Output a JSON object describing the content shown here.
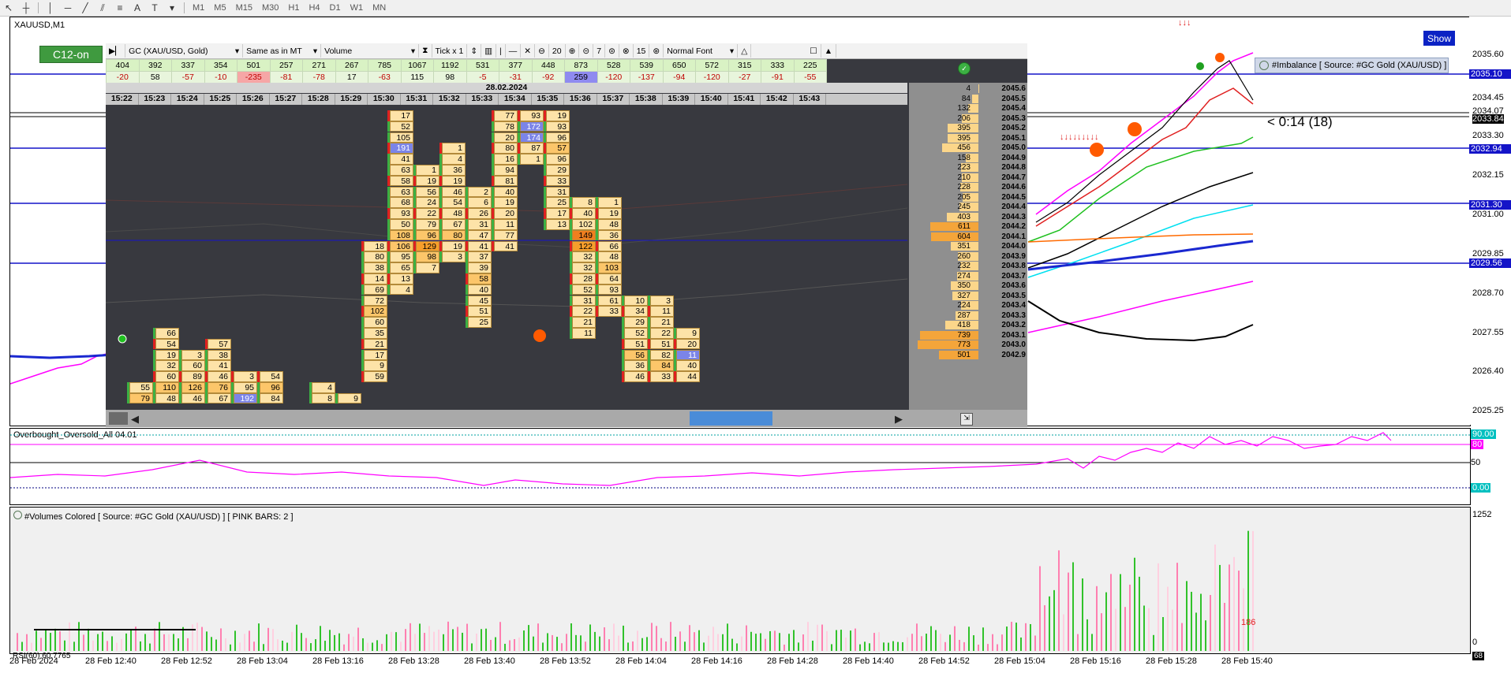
{
  "toolbar": {
    "timeframes": [
      "M1",
      "M5",
      "M15",
      "M30",
      "H1",
      "H4",
      "D1",
      "W1",
      "MN"
    ]
  },
  "chart": {
    "symbol": "XAUUSD,M1",
    "c12_label": "C12-on",
    "show_label": "Show",
    "timer": "< 0:14 (18)",
    "imbalance_label": "#Imbalance [ Source: #GC Gold (XAU/USD) ]",
    "price_labels": [
      "2035.60",
      "2034.45",
      "2034.07",
      "2033.84",
      "2033.30",
      "2032.15",
      "2031.00",
      "2029.85",
      "2028.70",
      "2027.55",
      "2026.40",
      "2025.25"
    ],
    "level_boxes": [
      {
        "value": "2035.10",
        "color": "#1414c8"
      },
      {
        "value": "2032.94",
        "color": "#1414c8"
      },
      {
        "value": "2031.30",
        "color": "#1414c8"
      },
      {
        "value": "2029.56",
        "color": "#1414c8"
      }
    ]
  },
  "footprint": {
    "symbol_select": "GC (XAU/USD, Gold)",
    "mode_select": "Same as in MT",
    "volume_select": "Volume",
    "tick_label": "Tick x 1",
    "zoom_value": "20",
    "step_value": "7",
    "ladder_value": "15",
    "font_select": "Normal Font",
    "date": "28.02.2024",
    "totals": [
      "404",
      "392",
      "337",
      "354",
      "501",
      "257",
      "271",
      "267",
      "785",
      "1067",
      "1192",
      "531",
      "377",
      "448",
      "873",
      "528",
      "539",
      "650",
      "572",
      "315",
      "333",
      "225"
    ],
    "deltas": [
      "-20",
      "58",
      "-57",
      "-10",
      "-235",
      "-81",
      "-78",
      "17",
      "-63",
      "115",
      "98",
      "-5",
      "-31",
      "-92",
      "259",
      "-120",
      "-137",
      "-94",
      "-120",
      "-27",
      "-91",
      "-55"
    ],
    "times": [
      "15:22",
      "15:23",
      "15:24",
      "15:25",
      "15:26",
      "15:27",
      "15:28",
      "15:29",
      "15:30",
      "15:31",
      "15:32",
      "15:33",
      "15:34",
      "15:35",
      "15:36",
      "15:37",
      "15:38",
      "15:39",
      "15:40",
      "15:41",
      "15:42",
      "15:43"
    ],
    "profile": [
      {
        "v": "4",
        "p": "2045.6"
      },
      {
        "v": "84",
        "p": "2045.5"
      },
      {
        "v": "132",
        "p": "2045.4"
      },
      {
        "v": "206",
        "p": "2045.3"
      },
      {
        "v": "395",
        "p": "2045.2"
      },
      {
        "v": "395",
        "p": "2045.1"
      },
      {
        "v": "456",
        "p": "2045.0"
      },
      {
        "v": "158",
        "p": "2044.9"
      },
      {
        "v": "223",
        "p": "2044.8"
      },
      {
        "v": "210",
        "p": "2044.7"
      },
      {
        "v": "228",
        "p": "2044.6"
      },
      {
        "v": "205",
        "p": "2044.5"
      },
      {
        "v": "245",
        "p": "2044.4"
      },
      {
        "v": "403",
        "p": "2044.3"
      },
      {
        "v": "611",
        "p": "2044.2"
      },
      {
        "v": "604",
        "p": "2044.1"
      },
      {
        "v": "351",
        "p": "2044.0"
      },
      {
        "v": "260",
        "p": "2043.9"
      },
      {
        "v": "232",
        "p": "2043.8"
      },
      {
        "v": "274",
        "p": "2043.7"
      },
      {
        "v": "350",
        "p": "2043.6"
      },
      {
        "v": "327",
        "p": "2043.5"
      },
      {
        "v": "224",
        "p": "2043.4"
      },
      {
        "v": "287",
        "p": "2043.3"
      },
      {
        "v": "418",
        "p": "2043.2"
      },
      {
        "v": "739",
        "p": "2043.1"
      },
      {
        "v": "773",
        "p": "2043.0"
      },
      {
        "v": "501",
        "p": "2042.9"
      }
    ],
    "cells": [
      {
        "c": 1,
        "r": 20,
        "v": "66",
        "t": "lo"
      },
      {
        "c": 1,
        "r": 21,
        "v": "54",
        "t": "lo"
      },
      {
        "c": 1,
        "r": 22,
        "v": "19",
        "t": "lo"
      },
      {
        "c": 1,
        "r": 23,
        "v": "32",
        "t": "lo"
      },
      {
        "c": 1,
        "r": 24,
        "v": "60",
        "t": "lo"
      },
      {
        "c": 1,
        "r": 25,
        "v": "110",
        "t": "mid"
      },
      {
        "c": 1,
        "r": 26,
        "v": "48",
        "t": "lo"
      },
      {
        "c": 0,
        "r": 25,
        "v": "55",
        "t": "lo"
      },
      {
        "c": 0,
        "r": 26,
        "v": "79",
        "t": "mid"
      },
      {
        "c": 2,
        "r": 22,
        "v": "3",
        "t": "lo"
      },
      {
        "c": 2,
        "r": 23,
        "v": "60",
        "t": "lo"
      },
      {
        "c": 2,
        "r": 24,
        "v": "89",
        "t": "lo"
      },
      {
        "c": 2,
        "r": 25,
        "v": "126",
        "t": "mid"
      },
      {
        "c": 2,
        "r": 26,
        "v": "46",
        "t": "lo"
      },
      {
        "c": 3,
        "r": 21,
        "v": "57",
        "t": "lo"
      },
      {
        "c": 3,
        "r": 22,
        "v": "38",
        "t": "lo"
      },
      {
        "c": 3,
        "r": 23,
        "v": "41",
        "t": "lo"
      },
      {
        "c": 3,
        "r": 24,
        "v": "46",
        "t": "lo"
      },
      {
        "c": 3,
        "r": 25,
        "v": "76",
        "t": "mid"
      },
      {
        "c": 3,
        "r": 26,
        "v": "67",
        "t": "lo"
      },
      {
        "c": 4,
        "r": 24,
        "v": "3",
        "t": "lo"
      },
      {
        "c": 4,
        "r": 25,
        "v": "95",
        "t": "lo"
      },
      {
        "c": 4,
        "r": 26,
        "v": "192",
        "t": "blue"
      },
      {
        "c": 5,
        "r": 24,
        "v": "54",
        "t": "lo"
      },
      {
        "c": 5,
        "r": 25,
        "v": "96",
        "t": "mid"
      },
      {
        "c": 5,
        "r": 26,
        "v": "84",
        "t": "lo"
      },
      {
        "c": 7,
        "r": 25,
        "v": "4",
        "t": "lo"
      },
      {
        "c": 7,
        "r": 26,
        "v": "8",
        "t": "lo"
      },
      {
        "c": 8,
        "r": 26,
        "v": "9",
        "t": "lo"
      },
      {
        "c": 9,
        "r": 12,
        "v": "18",
        "t": "lo"
      },
      {
        "c": 9,
        "r": 13,
        "v": "80",
        "t": "lo"
      },
      {
        "c": 9,
        "r": 14,
        "v": "38",
        "t": "lo"
      },
      {
        "c": 9,
        "r": 15,
        "v": "14",
        "t": "lo"
      },
      {
        "c": 9,
        "r": 16,
        "v": "69",
        "t": "lo"
      },
      {
        "c": 9,
        "r": 17,
        "v": "72",
        "t": "lo"
      },
      {
        "c": 9,
        "r": 18,
        "v": "102",
        "t": "mid"
      },
      {
        "c": 9,
        "r": 19,
        "v": "60",
        "t": "lo"
      },
      {
        "c": 9,
        "r": 20,
        "v": "35",
        "t": "lo"
      },
      {
        "c": 9,
        "r": 21,
        "v": "21",
        "t": "lo"
      },
      {
        "c": 9,
        "r": 22,
        "v": "17",
        "t": "lo"
      },
      {
        "c": 9,
        "r": 23,
        "v": "9",
        "t": "lo"
      },
      {
        "c": 9,
        "r": 24,
        "v": "59",
        "t": "lo"
      },
      {
        "c": 10,
        "r": 0,
        "v": "17",
        "t": "lo"
      },
      {
        "c": 10,
        "r": 1,
        "v": "52",
        "t": "lo"
      },
      {
        "c": 10,
        "r": 2,
        "v": "105",
        "t": "lo"
      },
      {
        "c": 10,
        "r": 3,
        "v": "191",
        "t": "blue"
      },
      {
        "c": 10,
        "r": 4,
        "v": "41",
        "t": "lo"
      },
      {
        "c": 10,
        "r": 5,
        "v": "63",
        "t": "lo"
      },
      {
        "c": 10,
        "r": 6,
        "v": "58",
        "t": "lo"
      },
      {
        "c": 10,
        "r": 7,
        "v": "63",
        "t": "lo"
      },
      {
        "c": 10,
        "r": 8,
        "v": "68",
        "t": "lo"
      },
      {
        "c": 10,
        "r": 9,
        "v": "93",
        "t": "lo"
      },
      {
        "c": 10,
        "r": 10,
        "v": "50",
        "t": "lo"
      },
      {
        "c": 10,
        "r": 11,
        "v": "108",
        "t": "mid"
      },
      {
        "c": 10,
        "r": 12,
        "v": "106",
        "t": "mid"
      },
      {
        "c": 10,
        "r": 13,
        "v": "95",
        "t": "lo"
      },
      {
        "c": 10,
        "r": 14,
        "v": "65",
        "t": "lo"
      },
      {
        "c": 10,
        "r": 15,
        "v": "13",
        "t": "lo"
      },
      {
        "c": 10,
        "r": 16,
        "v": "4",
        "t": "lo"
      },
      {
        "c": 11,
        "r": 5,
        "v": "1",
        "t": "lo"
      },
      {
        "c": 11,
        "r": 6,
        "v": "19",
        "t": "lo"
      },
      {
        "c": 11,
        "r": 7,
        "v": "56",
        "t": "lo"
      },
      {
        "c": 11,
        "r": 8,
        "v": "24",
        "t": "lo"
      },
      {
        "c": 11,
        "r": 9,
        "v": "22",
        "t": "lo"
      },
      {
        "c": 11,
        "r": 10,
        "v": "79",
        "t": "lo"
      },
      {
        "c": 11,
        "r": 11,
        "v": "96",
        "t": "mid"
      },
      {
        "c": 11,
        "r": 12,
        "v": "129",
        "t": "hi"
      },
      {
        "c": 11,
        "r": 13,
        "v": "98",
        "t": "mid"
      },
      {
        "c": 11,
        "r": 14,
        "v": "7",
        "t": "lo"
      },
      {
        "c": 12,
        "r": 3,
        "v": "1",
        "t": "lo"
      },
      {
        "c": 12,
        "r": 4,
        "v": "4",
        "t": "lo"
      },
      {
        "c": 12,
        "r": 5,
        "v": "36",
        "t": "lo"
      },
      {
        "c": 12,
        "r": 6,
        "v": "19",
        "t": "lo"
      },
      {
        "c": 12,
        "r": 7,
        "v": "46",
        "t": "lo"
      },
      {
        "c": 12,
        "r": 8,
        "v": "54",
        "t": "lo"
      },
      {
        "c": 12,
        "r": 9,
        "v": "48",
        "t": "lo"
      },
      {
        "c": 12,
        "r": 10,
        "v": "67",
        "t": "lo"
      },
      {
        "c": 12,
        "r": 11,
        "v": "80",
        "t": "mid"
      },
      {
        "c": 12,
        "r": 12,
        "v": "19",
        "t": "lo"
      },
      {
        "c": 12,
        "r": 13,
        "v": "3",
        "t": "lo"
      },
      {
        "c": 13,
        "r": 7,
        "v": "2",
        "t": "lo"
      },
      {
        "c": 13,
        "r": 8,
        "v": "6",
        "t": "lo"
      },
      {
        "c": 13,
        "r": 9,
        "v": "26",
        "t": "lo"
      },
      {
        "c": 13,
        "r": 10,
        "v": "31",
        "t": "lo"
      },
      {
        "c": 13,
        "r": 11,
        "v": "47",
        "t": "lo"
      },
      {
        "c": 13,
        "r": 12,
        "v": "41",
        "t": "lo"
      },
      {
        "c": 13,
        "r": 13,
        "v": "37",
        "t": "lo"
      },
      {
        "c": 13,
        "r": 14,
        "v": "39",
        "t": "lo"
      },
      {
        "c": 13,
        "r": 15,
        "v": "58",
        "t": "mid"
      },
      {
        "c": 13,
        "r": 16,
        "v": "40",
        "t": "lo"
      },
      {
        "c": 13,
        "r": 17,
        "v": "45",
        "t": "lo"
      },
      {
        "c": 13,
        "r": 18,
        "v": "51",
        "t": "lo"
      },
      {
        "c": 13,
        "r": 19,
        "v": "25",
        "t": "lo"
      },
      {
        "c": 14,
        "r": 0,
        "v": "77",
        "t": "lo"
      },
      {
        "c": 14,
        "r": 1,
        "v": "78",
        "t": "lo"
      },
      {
        "c": 14,
        "r": 2,
        "v": "20",
        "t": "lo"
      },
      {
        "c": 14,
        "r": 3,
        "v": "80",
        "t": "lo"
      },
      {
        "c": 14,
        "r": 4,
        "v": "16",
        "t": "lo"
      },
      {
        "c": 14,
        "r": 5,
        "v": "94",
        "t": "lo"
      },
      {
        "c": 14,
        "r": 6,
        "v": "81",
        "t": "lo"
      },
      {
        "c": 14,
        "r": 7,
        "v": "40",
        "t": "lo"
      },
      {
        "c": 14,
        "r": 8,
        "v": "19",
        "t": "lo"
      },
      {
        "c": 14,
        "r": 9,
        "v": "20",
        "t": "lo"
      },
      {
        "c": 14,
        "r": 10,
        "v": "11",
        "t": "lo"
      },
      {
        "c": 14,
        "r": 11,
        "v": "77",
        "t": "lo"
      },
      {
        "c": 14,
        "r": 12,
        "v": "41",
        "t": "lo"
      },
      {
        "c": 15,
        "r": 0,
        "v": "93",
        "t": "lo"
      },
      {
        "c": 15,
        "r": 1,
        "v": "172",
        "t": "blue"
      },
      {
        "c": 15,
        "r": 2,
        "v": "174",
        "t": "blue"
      },
      {
        "c": 15,
        "r": 3,
        "v": "87",
        "t": "lo"
      },
      {
        "c": 15,
        "r": 4,
        "v": "1",
        "t": "lo"
      },
      {
        "c": 16,
        "r": 0,
        "v": "19",
        "t": "lo"
      },
      {
        "c": 16,
        "r": 1,
        "v": "93",
        "t": "lo"
      },
      {
        "c": 16,
        "r": 2,
        "v": "96",
        "t": "lo"
      },
      {
        "c": 16,
        "r": 3,
        "v": "57",
        "t": "mid"
      },
      {
        "c": 16,
        "r": 4,
        "v": "96",
        "t": "lo"
      },
      {
        "c": 16,
        "r": 5,
        "v": "29",
        "t": "lo"
      },
      {
        "c": 16,
        "r": 6,
        "v": "33",
        "t": "lo"
      },
      {
        "c": 16,
        "r": 7,
        "v": "31",
        "t": "lo"
      },
      {
        "c": 16,
        "r": 8,
        "v": "25",
        "t": "lo"
      },
      {
        "c": 16,
        "r": 9,
        "v": "17",
        "t": "lo"
      },
      {
        "c": 16,
        "r": 10,
        "v": "13",
        "t": "lo"
      },
      {
        "c": 17,
        "r": 8,
        "v": "8",
        "t": "lo"
      },
      {
        "c": 17,
        "r": 9,
        "v": "40",
        "t": "lo"
      },
      {
        "c": 17,
        "r": 10,
        "v": "102",
        "t": "lo"
      },
      {
        "c": 17,
        "r": 11,
        "v": "149",
        "t": "vhi"
      },
      {
        "c": 17,
        "r": 12,
        "v": "122",
        "t": "hi"
      },
      {
        "c": 17,
        "r": 13,
        "v": "32",
        "t": "lo"
      },
      {
        "c": 17,
        "r": 14,
        "v": "32",
        "t": "lo"
      },
      {
        "c": 17,
        "r": 15,
        "v": "28",
        "t": "lo"
      },
      {
        "c": 17,
        "r": 16,
        "v": "52",
        "t": "lo"
      },
      {
        "c": 17,
        "r": 17,
        "v": "31",
        "t": "lo"
      },
      {
        "c": 17,
        "r": 18,
        "v": "22",
        "t": "lo"
      },
      {
        "c": 17,
        "r": 19,
        "v": "21",
        "t": "lo"
      },
      {
        "c": 17,
        "r": 20,
        "v": "11",
        "t": "lo"
      },
      {
        "c": 18,
        "r": 8,
        "v": "1",
        "t": "lo"
      },
      {
        "c": 18,
        "r": 9,
        "v": "19",
        "t": "lo"
      },
      {
        "c": 18,
        "r": 10,
        "v": "48",
        "t": "lo"
      },
      {
        "c": 18,
        "r": 11,
        "v": "36",
        "t": "lo"
      },
      {
        "c": 18,
        "r": 12,
        "v": "66",
        "t": "lo"
      },
      {
        "c": 18,
        "r": 13,
        "v": "48",
        "t": "lo"
      },
      {
        "c": 18,
        "r": 14,
        "v": "103",
        "t": "mid"
      },
      {
        "c": 18,
        "r": 15,
        "v": "64",
        "t": "lo"
      },
      {
        "c": 18,
        "r": 16,
        "v": "93",
        "t": "lo"
      },
      {
        "c": 18,
        "r": 17,
        "v": "61",
        "t": "lo"
      },
      {
        "c": 18,
        "r": 18,
        "v": "33",
        "t": "lo"
      },
      {
        "c": 19,
        "r": 17,
        "v": "10",
        "t": "lo"
      },
      {
        "c": 19,
        "r": 18,
        "v": "34",
        "t": "lo"
      },
      {
        "c": 19,
        "r": 19,
        "v": "29",
        "t": "lo"
      },
      {
        "c": 19,
        "r": 20,
        "v": "52",
        "t": "lo"
      },
      {
        "c": 19,
        "r": 21,
        "v": "51",
        "t": "lo"
      },
      {
        "c": 19,
        "r": 22,
        "v": "56",
        "t": "mid"
      },
      {
        "c": 19,
        "r": 23,
        "v": "36",
        "t": "lo"
      },
      {
        "c": 19,
        "r": 24,
        "v": "46",
        "t": "lo"
      },
      {
        "c": 20,
        "r": 17,
        "v": "3",
        "t": "lo"
      },
      {
        "c": 20,
        "r": 18,
        "v": "11",
        "t": "lo"
      },
      {
        "c": 20,
        "r": 19,
        "v": "21",
        "t": "lo"
      },
      {
        "c": 20,
        "r": 20,
        "v": "22",
        "t": "lo"
      },
      {
        "c": 20,
        "r": 21,
        "v": "51",
        "t": "lo"
      },
      {
        "c": 20,
        "r": 22,
        "v": "82",
        "t": "lo"
      },
      {
        "c": 20,
        "r": 23,
        "v": "84",
        "t": "mid"
      },
      {
        "c": 20,
        "r": 24,
        "v": "33",
        "t": "lo"
      },
      {
        "c": 21,
        "r": 20,
        "v": "9",
        "t": "lo"
      },
      {
        "c": 21,
        "r": 21,
        "v": "20",
        "t": "lo"
      },
      {
        "c": 21,
        "r": 22,
        "v": "11",
        "t": "blue"
      },
      {
        "c": 21,
        "r": 23,
        "v": "40",
        "t": "lo"
      },
      {
        "c": 21,
        "r": 24,
        "v": "44",
        "t": "lo"
      }
    ]
  },
  "osc": {
    "label": "Overbought_Oversold_All 04.01",
    "levels": [
      {
        "value": "90.00",
        "color": "#00c0c0"
      },
      {
        "value": "80",
        "color": "#ff00ff"
      },
      {
        "value": "50",
        "color": "#000000"
      },
      {
        "value": "0.00",
        "color": "#00c0c0"
      }
    ]
  },
  "volumes": {
    "label": "#Volumes Colored [ Source: #GC Gold (XAU/USD) ]  [ PINK BARS: 2 ]",
    "max_label": "1252",
    "zero_label": "0",
    "last_value": "186",
    "corner_value": "68"
  },
  "xaxis": {
    "rsi_label": "RSI(60) 60.7765",
    "labels": [
      "28 Feb 2024",
      "28 Feb 12:40",
      "28 Feb 12:52",
      "28 Feb 13:04",
      "28 Feb 13:16",
      "28 Feb 13:28",
      "28 Feb 13:40",
      "28 Feb 13:52",
      "28 Feb 14:04",
      "28 Feb 14:16",
      "28 Feb 14:28",
      "28 Feb 14:40",
      "28 Feb 14:52",
      "28 Feb 15:04",
      "28 Feb 15:16",
      "28 Feb 15:28",
      "28 Feb 15:40"
    ]
  }
}
